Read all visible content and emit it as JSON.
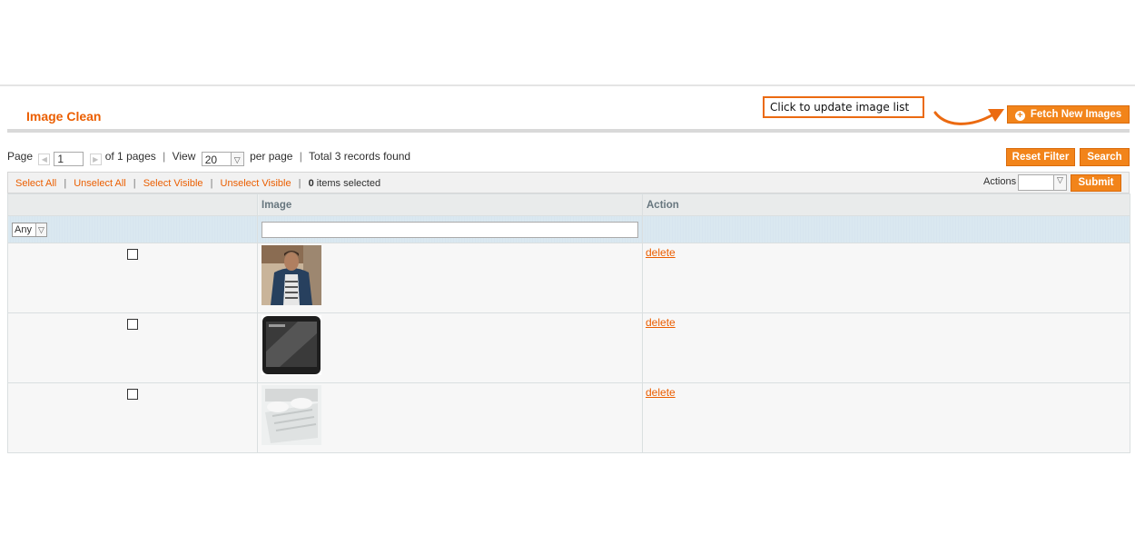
{
  "page": {
    "title": "Image Clean"
  },
  "callout": {
    "text": "Click to update image list"
  },
  "buttons": {
    "fetch": "Fetch New Images",
    "reset_filter": "Reset Filter",
    "search": "Search",
    "submit": "Submit"
  },
  "pager": {
    "page_label": "Page",
    "page_value": "1",
    "of_pages": "of 1 pages",
    "view_label": "View",
    "view_value": "20",
    "per_page": "per page",
    "total": "Total 3 records found",
    "sep": "|"
  },
  "massaction": {
    "select_all": "Select All",
    "unselect_all": "Unselect All",
    "select_visible": "Select Visible",
    "unselect_visible": "Unselect Visible",
    "selected_count": "0",
    "selected_text": "items selected",
    "actions_label": "Actions"
  },
  "grid": {
    "columns": [
      "",
      "Image",
      "Action"
    ],
    "filter_any": "Any",
    "rows": [
      {
        "image": "man-jacket-photo",
        "action": "delete"
      },
      {
        "image": "smartphone-photo",
        "action": "delete"
      },
      {
        "image": "bedding-photo",
        "action": "delete"
      }
    ]
  },
  "colors": {
    "accent": "#eb5e00",
    "button": "#f2841a",
    "filter_row": "#d7e5ef"
  }
}
